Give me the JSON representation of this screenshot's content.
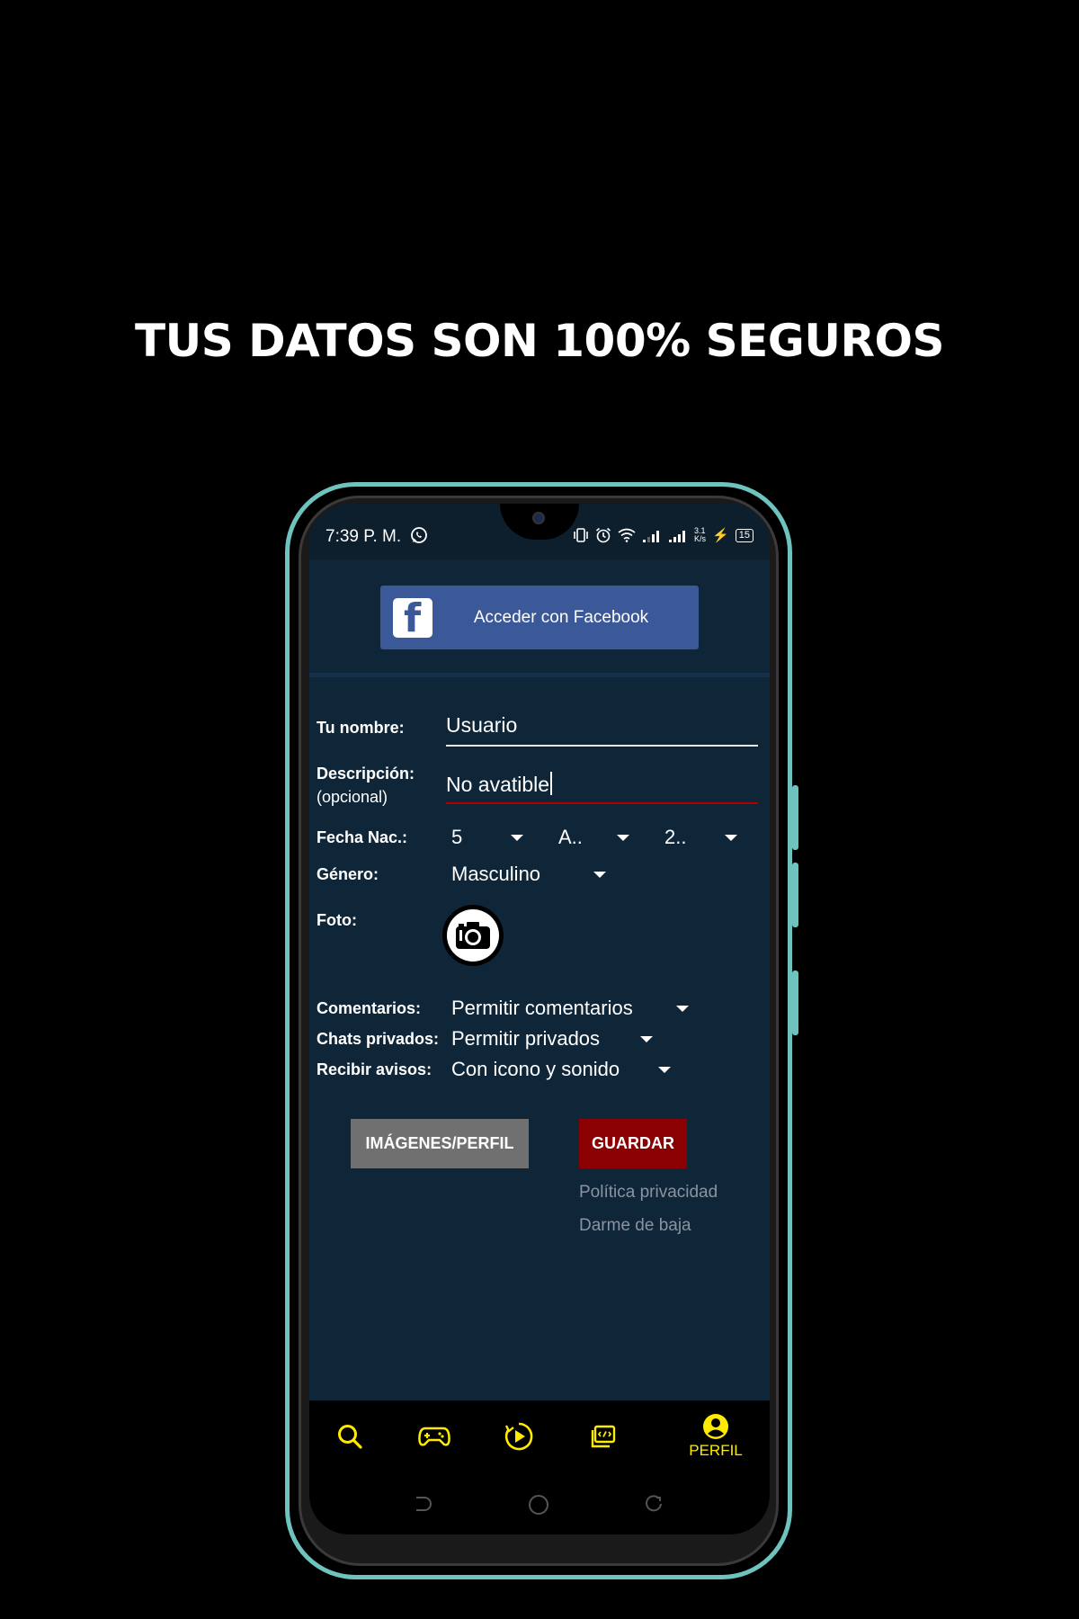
{
  "headline": "TUS DATOS SON 100% SEGUROS",
  "status": {
    "time": "7:39 P. M.",
    "speed_top": "3.1",
    "speed_bottom": "K/s",
    "battery": "15"
  },
  "facebook": {
    "label": "Acceder con Facebook",
    "logo": "f"
  },
  "form": {
    "name_label": "Tu nombre:",
    "name_value": "Usuario",
    "desc_label": "Descripción:",
    "desc_sub": "(opcional)",
    "desc_value": "No avatible",
    "birth_label": "Fecha Nac.:",
    "birth_day": "5",
    "birth_month": "A..",
    "birth_year": "2..",
    "gender_label": "Género:",
    "gender_value": "Masculino",
    "photo_label": "Foto:",
    "comments_label": "Comentarios:",
    "comments_value": "Permitir comentarios",
    "chats_label": "Chats privados:",
    "chats_value": "Permitir privados",
    "notify_label": "Recibir avisos:",
    "notify_value": "Con icono y sonido"
  },
  "buttons": {
    "images": "IMÁGENES/PERFIL",
    "save": "GUARDAR"
  },
  "links": {
    "privacy": "Política privacidad",
    "unsubscribe": "Darme de baja"
  },
  "nav": {
    "active_label": "PERFIL",
    "accent_color": "#ffeb00",
    "items": [
      "search-icon",
      "gamepad-icon",
      "play-icon",
      "video-editor-icon",
      "profile-icon"
    ]
  },
  "colors": {
    "screen_bg": "#0f2538",
    "facebook": "#3b5998",
    "save": "#8b0000",
    "images_button": "#707070",
    "phone_frame": "#6fc3bf"
  }
}
